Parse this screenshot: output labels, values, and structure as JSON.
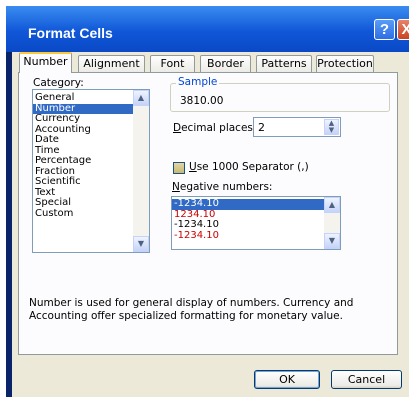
{
  "window": {
    "title": "Format Cells",
    "help_glyph": "?",
    "close_glyph": "X"
  },
  "tabs": [
    "Number",
    "Alignment",
    "Font",
    "Border",
    "Patterns",
    "Protection"
  ],
  "category": {
    "label": "Category:",
    "items": [
      "General",
      "Number",
      "Currency",
      "Accounting",
      "Date",
      "Time",
      "Percentage",
      "Fraction",
      "Scientific",
      "Text",
      "Special",
      "Custom"
    ],
    "selected": "Number"
  },
  "sample": {
    "label": "Sample",
    "value": "3810.00"
  },
  "decimal_places": {
    "label": "Decimal places:",
    "value": "2"
  },
  "separator": {
    "label": "Use 1000 Separator (,)",
    "checked": false
  },
  "negative_numbers": {
    "label": "Negative numbers:",
    "items": [
      {
        "text": "-1234.10",
        "color": "#000000"
      },
      {
        "text": "1234.10",
        "color": "#cc0000"
      },
      {
        "text": "-1234.10",
        "color": "#000000"
      },
      {
        "text": "-1234.10",
        "color": "#cc0000"
      }
    ],
    "selected_index": 0
  },
  "description": "Number is used for general display of numbers.  Currency and Accounting offer specialized formatting for monetary value.",
  "buttons": {
    "ok": "OK",
    "cancel": "Cancel"
  },
  "colors": {
    "title_bar": "#1057d8",
    "selection": "#316ac5",
    "dialog_bg": "#ece9d8",
    "accent_label": "#0046d5"
  }
}
